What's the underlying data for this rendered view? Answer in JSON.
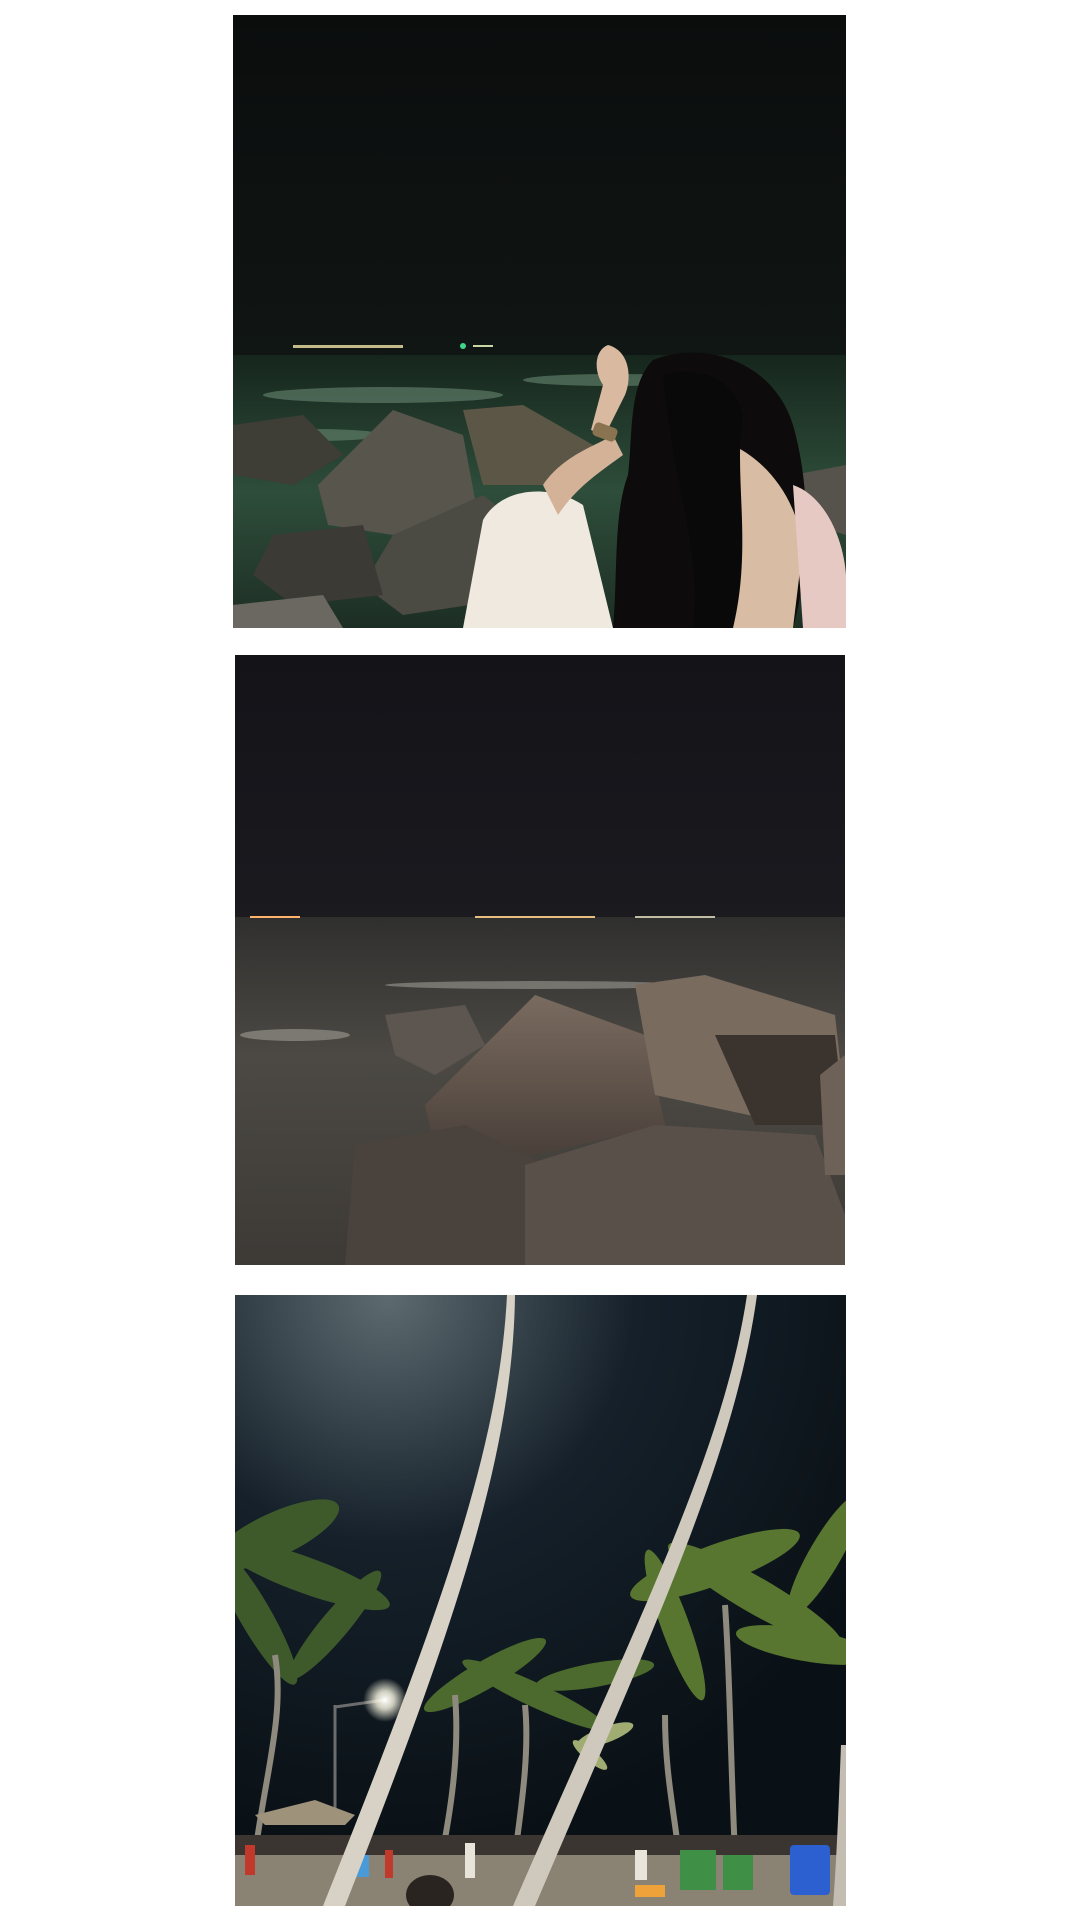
{
  "layout": {
    "background": "#ffffff"
  },
  "photos": [
    {
      "subject": "woman-by-sea-at-night",
      "palette": {
        "sky": "#0c0f0e",
        "sea": "#20382b",
        "foam": "#6f8f78",
        "rock": "#55534b",
        "hair": "#0b0a0a",
        "sleeve": "#f1ece4",
        "skin": "#d9b9a0",
        "shore_lights": "#e6d9a8"
      }
    },
    {
      "subject": "rocks-and-sea-at-night",
      "palette": {
        "sky": "#151419",
        "sea": "#4b4843",
        "foam": "#bdb9b0",
        "rock": "#6e6258",
        "rock_dark": "#3c3530",
        "shore_lights": "#ffb36b"
      }
    },
    {
      "subject": "palm-trees-beach-night",
      "palette": {
        "sky": "#0b1217",
        "sky_glow": "#5d6b70",
        "trunk": "#cfc9bd",
        "fronds": "#5f7a3a",
        "frond_light": "#c7d38a",
        "ground": "#8a8272",
        "bin_green": "#3f8f46",
        "bin_blue": "#2c5fd0",
        "lamp": "#ffffff"
      }
    }
  ]
}
